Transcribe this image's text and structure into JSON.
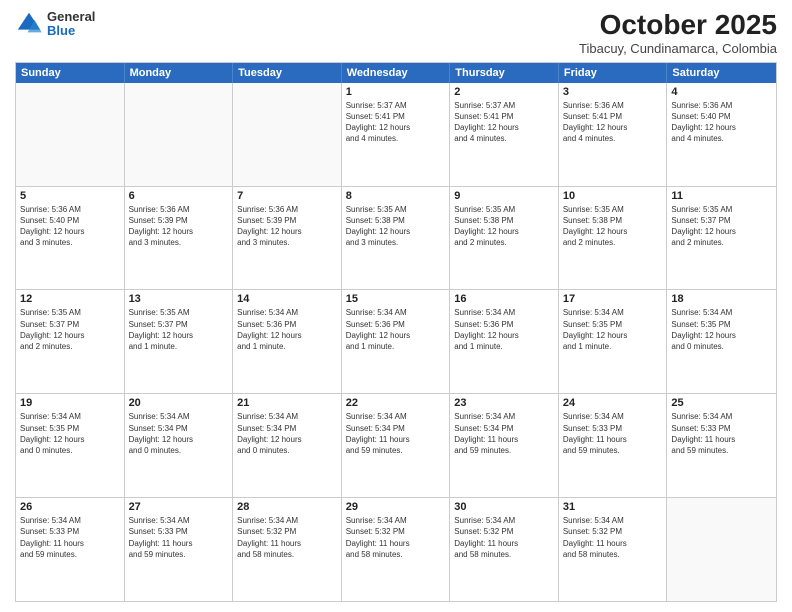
{
  "header": {
    "logo": {
      "general": "General",
      "blue": "Blue"
    },
    "title": "October 2025",
    "subtitle": "Tibacuy, Cundinamarca, Colombia"
  },
  "weekdays": [
    "Sunday",
    "Monday",
    "Tuesday",
    "Wednesday",
    "Thursday",
    "Friday",
    "Saturday"
  ],
  "rows": [
    [
      {
        "day": "",
        "info": ""
      },
      {
        "day": "",
        "info": ""
      },
      {
        "day": "",
        "info": ""
      },
      {
        "day": "1",
        "info": "Sunrise: 5:37 AM\nSunset: 5:41 PM\nDaylight: 12 hours\nand 4 minutes."
      },
      {
        "day": "2",
        "info": "Sunrise: 5:37 AM\nSunset: 5:41 PM\nDaylight: 12 hours\nand 4 minutes."
      },
      {
        "day": "3",
        "info": "Sunrise: 5:36 AM\nSunset: 5:41 PM\nDaylight: 12 hours\nand 4 minutes."
      },
      {
        "day": "4",
        "info": "Sunrise: 5:36 AM\nSunset: 5:40 PM\nDaylight: 12 hours\nand 4 minutes."
      }
    ],
    [
      {
        "day": "5",
        "info": "Sunrise: 5:36 AM\nSunset: 5:40 PM\nDaylight: 12 hours\nand 3 minutes."
      },
      {
        "day": "6",
        "info": "Sunrise: 5:36 AM\nSunset: 5:39 PM\nDaylight: 12 hours\nand 3 minutes."
      },
      {
        "day": "7",
        "info": "Sunrise: 5:36 AM\nSunset: 5:39 PM\nDaylight: 12 hours\nand 3 minutes."
      },
      {
        "day": "8",
        "info": "Sunrise: 5:35 AM\nSunset: 5:38 PM\nDaylight: 12 hours\nand 3 minutes."
      },
      {
        "day": "9",
        "info": "Sunrise: 5:35 AM\nSunset: 5:38 PM\nDaylight: 12 hours\nand 2 minutes."
      },
      {
        "day": "10",
        "info": "Sunrise: 5:35 AM\nSunset: 5:38 PM\nDaylight: 12 hours\nand 2 minutes."
      },
      {
        "day": "11",
        "info": "Sunrise: 5:35 AM\nSunset: 5:37 PM\nDaylight: 12 hours\nand 2 minutes."
      }
    ],
    [
      {
        "day": "12",
        "info": "Sunrise: 5:35 AM\nSunset: 5:37 PM\nDaylight: 12 hours\nand 2 minutes."
      },
      {
        "day": "13",
        "info": "Sunrise: 5:35 AM\nSunset: 5:37 PM\nDaylight: 12 hours\nand 1 minute."
      },
      {
        "day": "14",
        "info": "Sunrise: 5:34 AM\nSunset: 5:36 PM\nDaylight: 12 hours\nand 1 minute."
      },
      {
        "day": "15",
        "info": "Sunrise: 5:34 AM\nSunset: 5:36 PM\nDaylight: 12 hours\nand 1 minute."
      },
      {
        "day": "16",
        "info": "Sunrise: 5:34 AM\nSunset: 5:36 PM\nDaylight: 12 hours\nand 1 minute."
      },
      {
        "day": "17",
        "info": "Sunrise: 5:34 AM\nSunset: 5:35 PM\nDaylight: 12 hours\nand 1 minute."
      },
      {
        "day": "18",
        "info": "Sunrise: 5:34 AM\nSunset: 5:35 PM\nDaylight: 12 hours\nand 0 minutes."
      }
    ],
    [
      {
        "day": "19",
        "info": "Sunrise: 5:34 AM\nSunset: 5:35 PM\nDaylight: 12 hours\nand 0 minutes."
      },
      {
        "day": "20",
        "info": "Sunrise: 5:34 AM\nSunset: 5:34 PM\nDaylight: 12 hours\nand 0 minutes."
      },
      {
        "day": "21",
        "info": "Sunrise: 5:34 AM\nSunset: 5:34 PM\nDaylight: 12 hours\nand 0 minutes."
      },
      {
        "day": "22",
        "info": "Sunrise: 5:34 AM\nSunset: 5:34 PM\nDaylight: 11 hours\nand 59 minutes."
      },
      {
        "day": "23",
        "info": "Sunrise: 5:34 AM\nSunset: 5:34 PM\nDaylight: 11 hours\nand 59 minutes."
      },
      {
        "day": "24",
        "info": "Sunrise: 5:34 AM\nSunset: 5:33 PM\nDaylight: 11 hours\nand 59 minutes."
      },
      {
        "day": "25",
        "info": "Sunrise: 5:34 AM\nSunset: 5:33 PM\nDaylight: 11 hours\nand 59 minutes."
      }
    ],
    [
      {
        "day": "26",
        "info": "Sunrise: 5:34 AM\nSunset: 5:33 PM\nDaylight: 11 hours\nand 59 minutes."
      },
      {
        "day": "27",
        "info": "Sunrise: 5:34 AM\nSunset: 5:33 PM\nDaylight: 11 hours\nand 59 minutes."
      },
      {
        "day": "28",
        "info": "Sunrise: 5:34 AM\nSunset: 5:32 PM\nDaylight: 11 hours\nand 58 minutes."
      },
      {
        "day": "29",
        "info": "Sunrise: 5:34 AM\nSunset: 5:32 PM\nDaylight: 11 hours\nand 58 minutes."
      },
      {
        "day": "30",
        "info": "Sunrise: 5:34 AM\nSunset: 5:32 PM\nDaylight: 11 hours\nand 58 minutes."
      },
      {
        "day": "31",
        "info": "Sunrise: 5:34 AM\nSunset: 5:32 PM\nDaylight: 11 hours\nand 58 minutes."
      },
      {
        "day": "",
        "info": ""
      }
    ]
  ]
}
